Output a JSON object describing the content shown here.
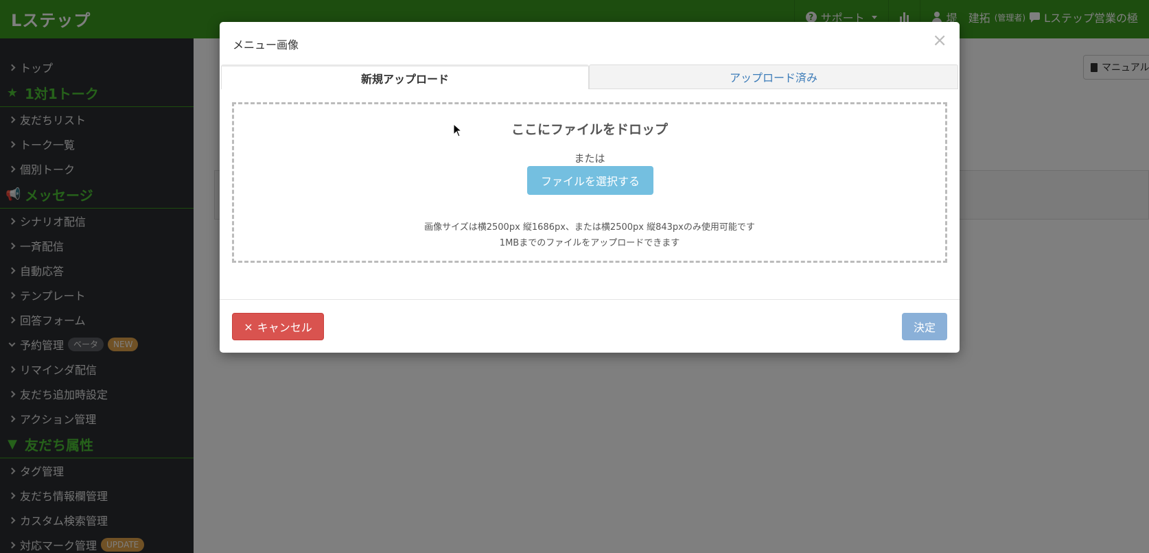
{
  "app": {
    "logo": "Lステップ"
  },
  "topnav": {
    "support": "サポート",
    "user_name": "堤　建拓",
    "user_role": "(管理者)",
    "account": "Lステップ営業の極"
  },
  "sidebar": {
    "top": "トップ",
    "sections": [
      {
        "header": "1対1トーク",
        "items": [
          "友だちリスト",
          "トーク一覧",
          "個別トーク"
        ]
      },
      {
        "header": "メッセージ",
        "items": [
          "シナリオ配信",
          "一斉配信",
          "自動応答",
          "テンプレート",
          "回答フォーム"
        ]
      },
      {
        "header": "友だち属性",
        "items": [
          "タグ管理",
          "友だち情報欄管理",
          "カスタム検索管理",
          "対応マーク管理"
        ]
      }
    ],
    "reservation": {
      "label": "予約管理",
      "badge_beta": "ベータ",
      "badge_new": "NEW"
    },
    "message_more": [
      "リマインダ配信",
      "友だち追加時設定",
      "アクション管理"
    ],
    "badge_update": "UPDATE"
  },
  "page": {
    "manual_label": "マニュアル"
  },
  "modal": {
    "title": "メニュー画像",
    "tabs": [
      {
        "label": "新規アップロード",
        "active": true
      },
      {
        "label": "アップロード済み",
        "active": false
      }
    ],
    "drop_title": "ここにファイルをドロップ",
    "or_text": "または",
    "select_button": "ファイルを選択する",
    "note_size": "画像サイズは横2500px 縦1686px、または横2500px 縦843pxのみ使用可能です",
    "note_limit": "1MBまでのファイルをアップロードできます",
    "cancel_button": "キャンセル",
    "decide_button": "決定"
  },
  "colors": {
    "brand_green": "#3a9a1f",
    "sidebar_bg": "#2a2d31",
    "sidebar_header": "#4cc235",
    "select_button": "#74bfe0",
    "cancel_button": "#d9534f",
    "decide_button": "#8ab0d8",
    "badge_orange": "#e0a24a"
  }
}
